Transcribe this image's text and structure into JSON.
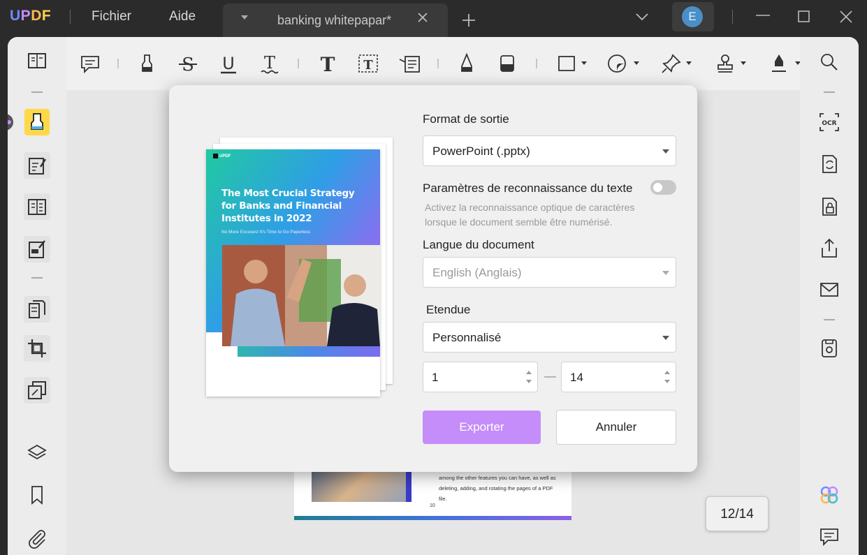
{
  "app": {
    "logo": "UPDF",
    "menu": {
      "file": "Fichier",
      "help": "Aide"
    },
    "tab": {
      "title": "banking whitepapar*"
    },
    "user_initial": "E"
  },
  "colors": {
    "accent": "#c48dfa",
    "active_tool": "#ffd84a",
    "app_bg": "#2b2b2b"
  },
  "toolbar": {
    "icons": [
      "comment-icon",
      "highlight-icon",
      "strikethrough-icon",
      "underline-icon",
      "squiggly-underline-icon",
      "text-icon",
      "text-box-icon",
      "text-callout-icon",
      "pencil-icon",
      "eraser-icon",
      "rectangle-shape-icon",
      "sticker-icon",
      "pin-icon",
      "stamp-icon",
      "signature-icon"
    ]
  },
  "left_rail": {
    "icons": [
      "reader-icon",
      "comment-mode-icon",
      "edit-pdf-icon",
      "form-icon",
      "fill-sign-icon",
      "organize-pages-icon",
      "crop-icon",
      "watermark-icon",
      "layers-icon",
      "bookmark-icon",
      "attachment-icon"
    ]
  },
  "right_rail": {
    "icons": [
      "search-icon",
      "ocr-icon",
      "convert-icon",
      "protect-icon",
      "share-icon",
      "email-icon",
      "save-icon",
      "ai-assistant-icon",
      "comments-panel-icon"
    ]
  },
  "background_page": {
    "lines": [
      "among the other features you can have, as well as",
      "deleting, adding, and rotating the pages of a PDF",
      "file."
    ],
    "page_number": "10"
  },
  "page_counter": "12/14",
  "dialog": {
    "preview": {
      "brand": "UPDF",
      "title": "The Most Crucial Strategy for Banks and Financial Institutes in 2022",
      "subtitle": "No More Excuses! It's Time to Go Paperless"
    },
    "output_format": {
      "label": "Format de sortie",
      "value": "PowerPoint (.pptx)"
    },
    "ocr": {
      "label": "Paramètres de reconnaissance du texte",
      "enabled": false,
      "hint": "Activez la reconnaissance optique de caractères lorsque le document semble être numérisé."
    },
    "language": {
      "label": "Langue du document",
      "value": "English (Anglais)"
    },
    "range": {
      "label": "Etendue",
      "value": "Personnalisé",
      "from": "1",
      "to": "14",
      "separator": "—"
    },
    "export_label": "Exporter",
    "cancel_label": "Annuler"
  }
}
